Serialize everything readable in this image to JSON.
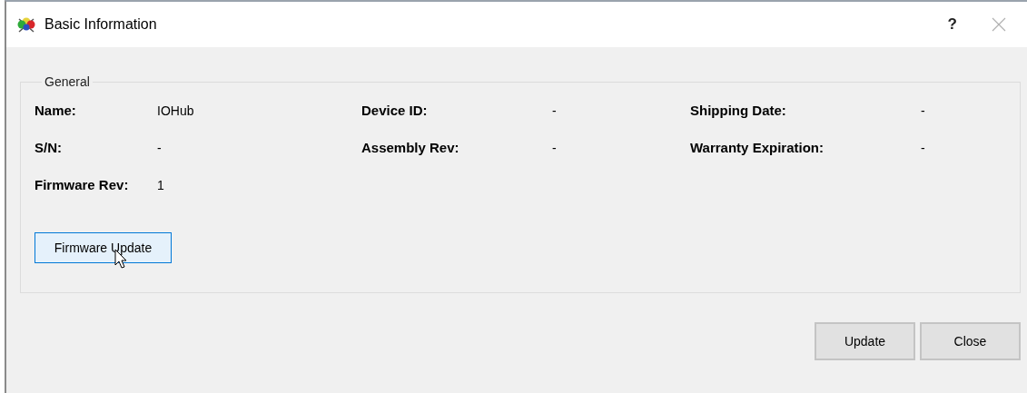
{
  "window": {
    "title": "Basic Information",
    "help": "?"
  },
  "group": {
    "title": "General",
    "fields": [
      {
        "label": "Name:",
        "value": "IOHub"
      },
      {
        "label": "Device ID:",
        "value": "-"
      },
      {
        "label": "Shipping Date:",
        "value": "-"
      },
      {
        "label": "S/N:",
        "value": "-"
      },
      {
        "label": "Assembly Rev:",
        "value": "-"
      },
      {
        "label": "Warranty Expiration:",
        "value": "-"
      },
      {
        "label": "Firmware Rev:",
        "value": "1"
      }
    ],
    "button": {
      "label": "Firmware Update",
      "hovered": true
    }
  },
  "buttons": [
    {
      "label": "Update",
      "hovered": false
    },
    {
      "label": "Close",
      "hovered": false
    }
  ]
}
